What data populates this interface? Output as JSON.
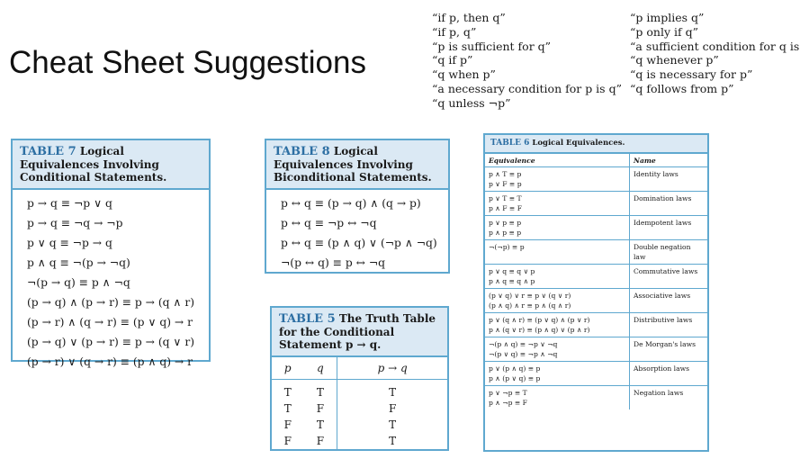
{
  "title": "Cheat Sheet Suggestions",
  "phrases_left": [
    "“if p, then q”",
    "“if p, q”",
    "“p is sufficient for q”",
    "“q if p”",
    "“q when p”",
    "“a necessary condition for p is q”",
    "“q unless ¬p”"
  ],
  "phrases_right": [
    "“p implies q”",
    "“p only if q”",
    "“a sufficient condition for q is p”",
    "“q whenever p”",
    "“q is necessary for p”",
    "“q follows from p”"
  ],
  "table7": {
    "label": "TABLE 7",
    "caption": "Logical Equivalences Involving Conditional Statements.",
    "rows": [
      "p → q ≡ ¬p ∨ q",
      "p → q ≡ ¬q → ¬p",
      "p ∨ q ≡ ¬p → q",
      "p ∧ q ≡ ¬(p → ¬q)",
      "¬(p → q) ≡ p ∧ ¬q",
      "(p → q) ∧ (p → r) ≡ p → (q ∧ r)",
      "(p → r) ∧ (q → r) ≡ (p ∨ q) → r",
      "(p → q) ∨ (p → r) ≡ p → (q ∨ r)",
      "(p → r) ∨ (q → r) ≡ (p ∧ q) → r"
    ]
  },
  "table8": {
    "label": "TABLE 8",
    "caption": "Logical Equivalences Involving Biconditional Statements.",
    "rows": [
      "p ↔ q ≡ (p → q) ∧ (q → p)",
      "p ↔ q ≡ ¬p ↔ ¬q",
      "p ↔ q ≡ (p ∧ q) ∨ (¬p ∧ ¬q)",
      "¬(p ↔ q) ≡ p ↔ ¬q"
    ]
  },
  "table5": {
    "label": "TABLE 5",
    "caption": "The Truth Table for the Conditional Statement p → q.",
    "headers": [
      "p",
      "q",
      "p → q"
    ],
    "rows": [
      [
        "T",
        "T",
        "T"
      ],
      [
        "T",
        "F",
        "F"
      ],
      [
        "F",
        "T",
        "T"
      ],
      [
        "F",
        "F",
        "T"
      ]
    ]
  },
  "table6": {
    "label": "TABLE 6",
    "caption": "Logical Equivalences.",
    "headers": [
      "Equivalence",
      "Name"
    ],
    "rows": [
      {
        "eq": [
          "p ∧ T ≡ p",
          "p ∨ F ≡ p"
        ],
        "name": "Identity laws"
      },
      {
        "eq": [
          "p ∨ T ≡ T",
          "p ∧ F ≡ F"
        ],
        "name": "Domination laws"
      },
      {
        "eq": [
          "p ∨ p ≡ p",
          "p ∧ p ≡ p"
        ],
        "name": "Idempotent laws"
      },
      {
        "eq": [
          "¬(¬p) ≡ p"
        ],
        "name": "Double negation law"
      },
      {
        "eq": [
          "p ∨ q ≡ q ∨ p",
          "p ∧ q ≡ q ∧ p"
        ],
        "name": "Commutative laws"
      },
      {
        "eq": [
          "(p ∨ q) ∨ r ≡ p ∨ (q ∨ r)",
          "(p ∧ q) ∧ r ≡ p ∧ (q ∧ r)"
        ],
        "name": "Associative laws"
      },
      {
        "eq": [
          "p ∨ (q ∧ r) ≡ (p ∨ q) ∧ (p ∨ r)",
          "p ∧ (q ∨ r) ≡ (p ∧ q) ∨ (p ∧ r)"
        ],
        "name": "Distributive laws"
      },
      {
        "eq": [
          "¬(p ∧ q) ≡ ¬p ∨ ¬q",
          "¬(p ∨ q) ≡ ¬p ∧ ¬q"
        ],
        "name": "De Morgan's laws"
      },
      {
        "eq": [
          "p ∨ (p ∧ q) ≡ p",
          "p ∧ (p ∨ q) ≡ p"
        ],
        "name": "Absorption laws"
      },
      {
        "eq": [
          "p ∨ ¬p ≡ T",
          "p ∧ ¬p ≡ F"
        ],
        "name": "Negation laws"
      }
    ]
  },
  "colors": {
    "table_border": "#5fa8cf",
    "table_header_bg": "#dbe9f4",
    "table_label": "#2d6fa3"
  }
}
